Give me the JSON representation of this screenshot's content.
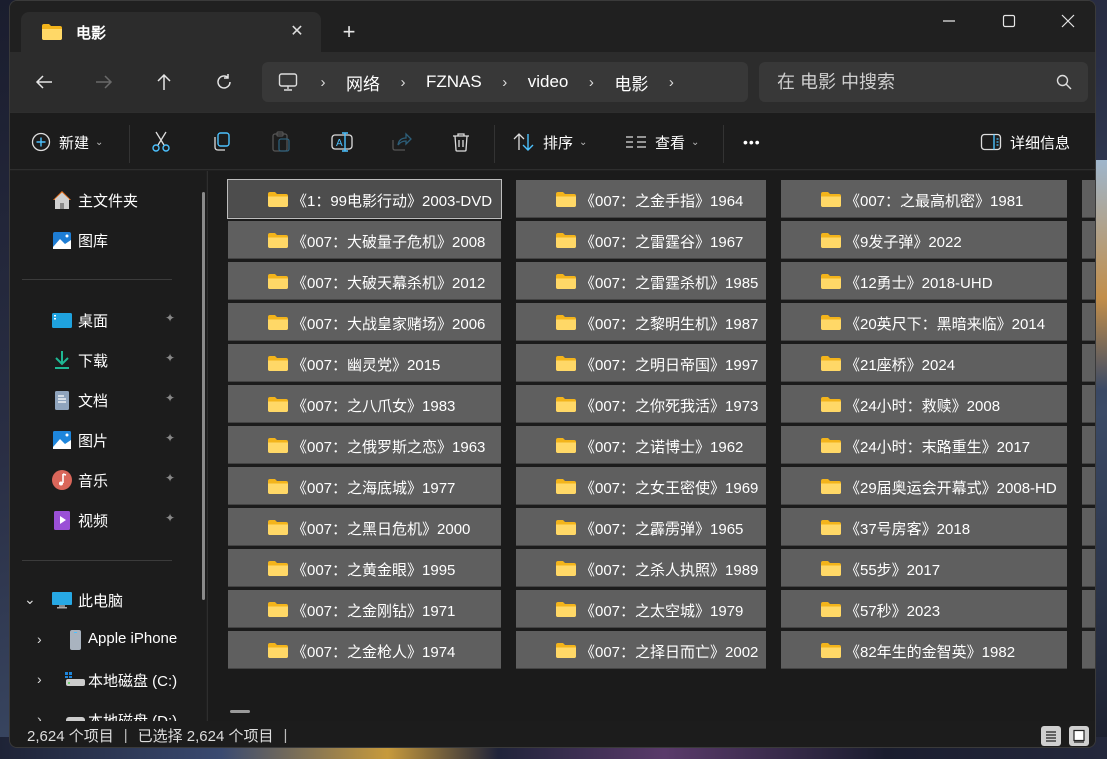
{
  "window": {
    "tab_title": "电影",
    "tab_close": "✕",
    "new_tab": "+",
    "controls": {
      "minimize": "—",
      "maximize": "☐",
      "close": "✕"
    }
  },
  "nav": {
    "back": "←",
    "forward": "→",
    "up": "↑",
    "refresh": "↻",
    "breadcrumb": [
      "网络",
      "FZNAS",
      "video",
      "电影"
    ],
    "separator": "›",
    "search_placeholder": "在 电影 中搜索"
  },
  "toolbar": {
    "new_label": "新建",
    "sort_label": "排序",
    "view_label": "查看",
    "more_label": "•••",
    "details_label": "详细信息",
    "chevron": "⌄",
    "icons": [
      "cut-icon",
      "copy-icon",
      "paste-icon",
      "rename-icon",
      "share-icon",
      "delete-icon"
    ]
  },
  "sidebar": {
    "top_items": [
      {
        "label": "主文件夹",
        "icon": "home-icon"
      },
      {
        "label": "图库",
        "icon": "gallery-icon"
      }
    ],
    "pinned_items": [
      {
        "label": "桌面",
        "icon": "desktop-icon"
      },
      {
        "label": "下载",
        "icon": "downloads-icon"
      },
      {
        "label": "文档",
        "icon": "documents-icon"
      },
      {
        "label": "图片",
        "icon": "pictures-icon"
      },
      {
        "label": "音乐",
        "icon": "music-icon"
      },
      {
        "label": "视频",
        "icon": "videos-icon"
      }
    ],
    "pin_glyph": "📌",
    "this_pc": {
      "label": "此电脑",
      "expanded": true
    },
    "devices": [
      {
        "label": "Apple iPhone",
        "icon": "phone-icon"
      },
      {
        "label": "本地磁盘 (C:)",
        "icon": "drive-c-icon"
      },
      {
        "label": "本地磁盘 (D:)",
        "icon": "drive-d-icon"
      }
    ]
  },
  "files": {
    "columns": [
      [
        "《1：99电影行动》2003-DVD",
        "《007：大破量子危机》2008",
        "《007：大破天幕杀机》2012",
        "《007：大战皇家赌场》2006",
        "《007：幽灵党》2015",
        "《007：之八爪女》1983",
        "《007：之俄罗斯之恋》1963",
        "《007：之海底城》1977",
        "《007：之黑日危机》2000",
        "《007：之黄金眼》1995",
        "《007：之金刚钻》1971",
        "《007：之金枪人》1974"
      ],
      [
        "《007：之金手指》1964",
        "《007：之雷霆谷》1967",
        "《007：之雷霆杀机》1985",
        "《007：之黎明生机》1987",
        "《007：之明日帝国》1997",
        "《007：之你死我活》1973",
        "《007：之诺博士》1962",
        "《007：之女王密使》1969",
        "《007：之霹雳弹》1965",
        "《007：之杀人执照》1989",
        "《007：之太空城》1979",
        "《007：之择日而亡》2002"
      ],
      [
        "《007：之最高机密》1981",
        "《9发子弹》2022",
        "《12勇士》2018-UHD",
        "《20英尺下：黑暗来临》2014",
        "《21座桥》2024",
        "《24小时：救赎》2008",
        "《24小时：末路重生》2017",
        "《29届奥运会开幕式》2008-HD",
        "《37号房客》2018",
        "《55步》2017",
        "《57秒》2023",
        "《82年生的金智英》1982"
      ]
    ],
    "focused_item": "《1：99电影行动》2003-DVD"
  },
  "status": {
    "item_count": "2,624 个项目",
    "selected": "已选择 2,624 个项目",
    "separator": "|"
  },
  "colors": {
    "accent": "#4cc2ff",
    "folder": "#f8c542",
    "tile": "#5f5f5f",
    "window": "#202020"
  }
}
